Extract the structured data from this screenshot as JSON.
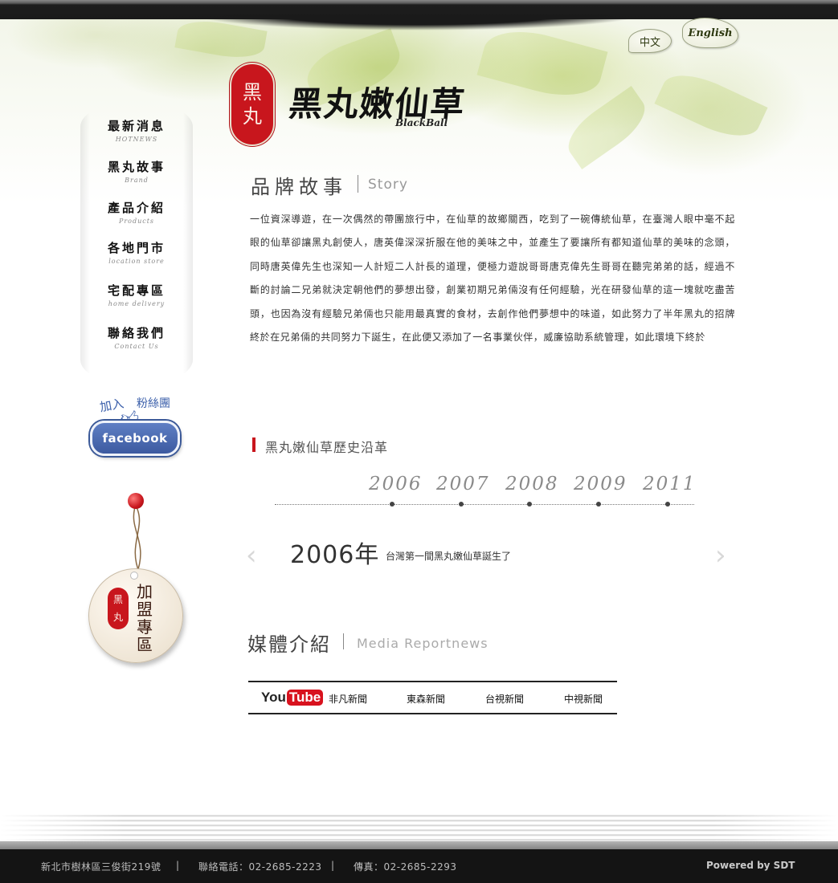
{
  "language": {
    "zh": "中文",
    "en": "English"
  },
  "brand": {
    "seal_chars": [
      "黑",
      "丸"
    ],
    "name": "黑丸嫩仙草",
    "name_en": "BlackBall"
  },
  "nav": [
    {
      "zh": "最新消息",
      "en": "HOTNEWS"
    },
    {
      "zh": "黑丸故事",
      "en": "Brand"
    },
    {
      "zh": "產品介紹",
      "en": "Products"
    },
    {
      "zh": "各地門市",
      "en": "location store"
    },
    {
      "zh": "宅配專區",
      "en": "home delivery"
    },
    {
      "zh": "聯絡我們",
      "en": "Contact Us"
    }
  ],
  "facebook": {
    "join": "加入",
    "fans": "粉絲團",
    "label": "facebook"
  },
  "franchise": {
    "seal_chars": [
      "黑",
      "丸"
    ],
    "text": "加盟專區"
  },
  "story": {
    "title": "品牌故事",
    "title_en": "Story",
    "body": "一位資深導遊，在一次偶然的帶團旅行中，在仙草的故鄉關西，吃到了一碗傳統仙草，在臺灣人眼中毫不起眼的仙草卻讓黑丸創使人，唐英偉深深折服在他的美味之中，並產生了要讓所有都知道仙草的美味的念頭，同時唐英偉先生也深知一人計短二人計長的道理，便極力遊說哥哥唐克偉先生哥哥在聽完弟弟的話，經過不斷的討論二兄弟就決定朝他們的夢想出發，創業初期兄弟倆沒有任何經驗，光在研發仙草的這一塊就吃盡苦頭，也因為沒有經驗兄弟倆也只能用最真實的食材，去創作他們夢想中的味道，如此努力了半年黑丸的招牌終於在兄弟倆的共同努力下誕生，在此便又添加了一名事業伙伴，威廉協助系統管理，如此環境下終於"
  },
  "history": {
    "title": "黑丸嫩仙草歷史沿革",
    "years": [
      "2006",
      "2007",
      "2008",
      "2009",
      "2011"
    ],
    "selected_year": "2006年",
    "selected_desc": "台灣第一間黑丸嫩仙草誕生了",
    "prev": "‹",
    "next": "›"
  },
  "media": {
    "title": "媒體介紹",
    "title_en": "Media Reportnews",
    "youtube": {
      "you": "You",
      "tube": "Tube"
    },
    "tabs": [
      "非凡新聞",
      "東森新聞",
      "台視新聞",
      "中視新聞"
    ]
  },
  "footer": {
    "address": "新北市樹林區三俊街219號",
    "sep1": "|",
    "phone": "聯絡電話：02-2685-2223",
    "sep2": "|",
    "fax": "傳真：02-2685-2293",
    "powered": "Powered by SDT"
  },
  "colors": {
    "brand_red": "#c8161d",
    "facebook_blue": "#3b5998",
    "youtube_red": "#d8121e"
  }
}
